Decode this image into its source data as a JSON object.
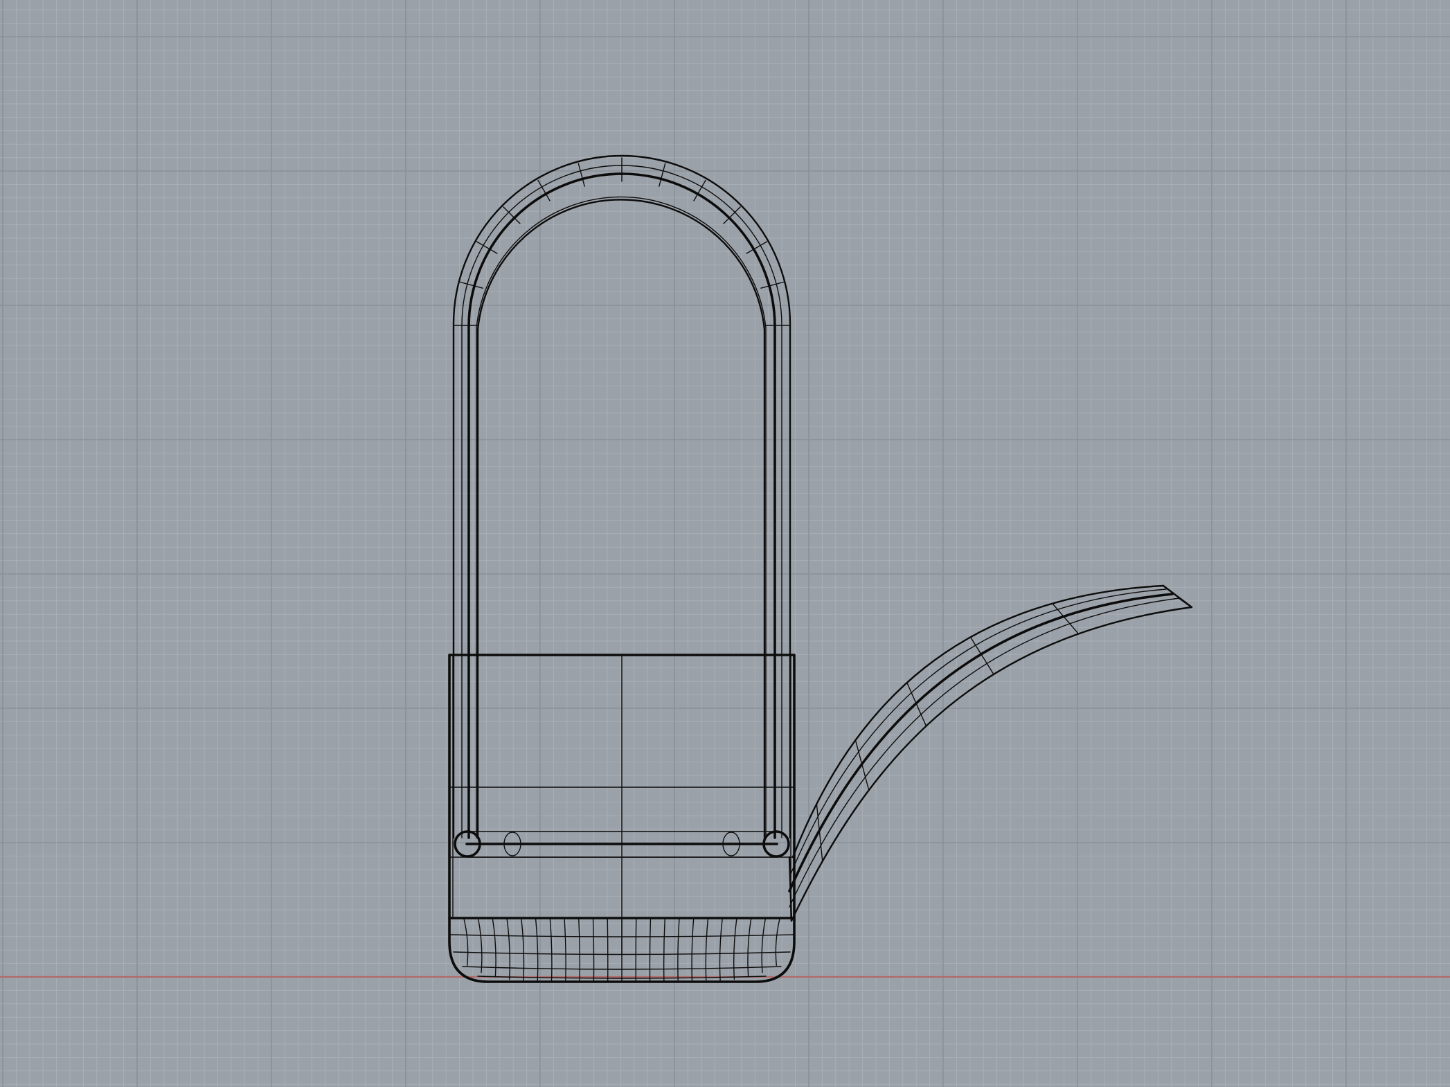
{
  "viewport": {
    "projection": "front",
    "display_mode": "wireframe",
    "grid_visible": true,
    "background_color": "#9ba1a8",
    "minor_grid_color": "#a9afb6",
    "major_grid_color": "#8a9098",
    "x_axis_color": "#b06a6a",
    "wireframe_color": "#0c0c0c"
  },
  "model": {
    "object_type": "watering-can",
    "parts": [
      "body-cylinder",
      "rounded-base",
      "loop-handle",
      "crossbar",
      "spout"
    ]
  }
}
